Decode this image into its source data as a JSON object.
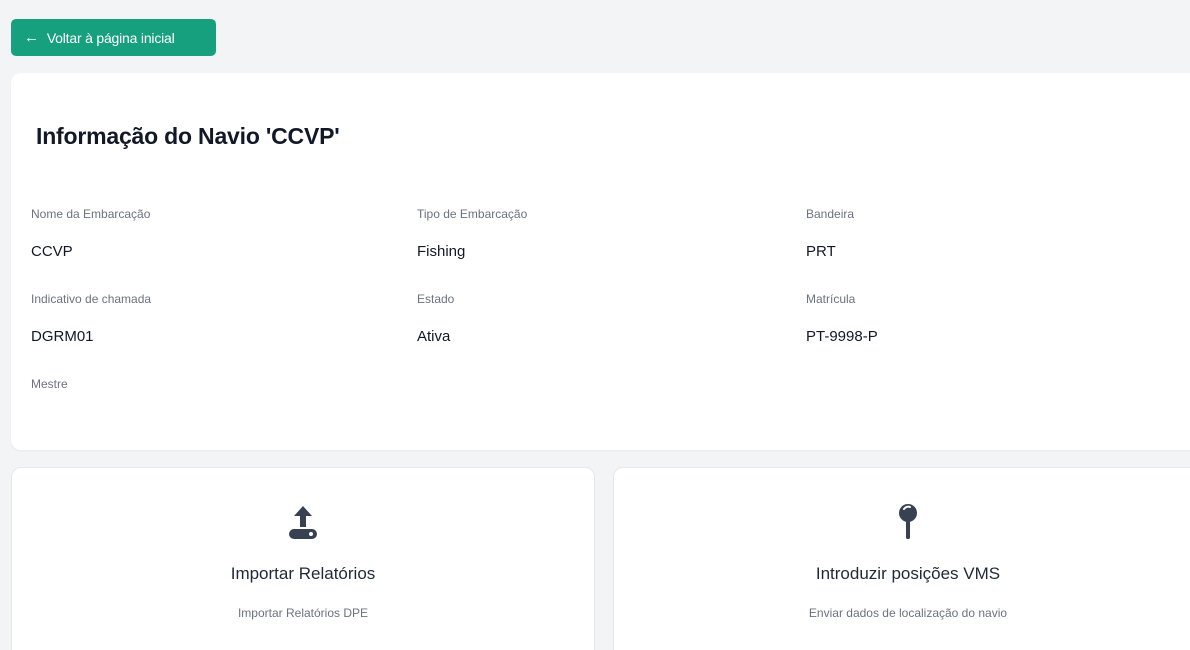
{
  "header": {
    "back_label": "Voltar à página inicial"
  },
  "vessel": {
    "title": "Informação do Navio 'CCVP'",
    "fields": [
      {
        "label": "Nome da Embarcação",
        "value": "CCVP"
      },
      {
        "label": "Tipo de Embarcação",
        "value": "Fishing"
      },
      {
        "label": "Bandeira",
        "value": "PRT"
      },
      {
        "label": "Indicativo de chamada",
        "value": "DGRM01"
      },
      {
        "label": "Estado",
        "value": "Ativa"
      },
      {
        "label": "Matrícula",
        "value": "PT-9998-P"
      },
      {
        "label": "Mestre",
        "value": ""
      }
    ]
  },
  "actions": [
    {
      "title": "Importar Relatórios",
      "description": "Importar Relatórios DPE",
      "icon": "upload-icon"
    },
    {
      "title": "Introduzir posições VMS",
      "description": "Enviar dados de localização do navio",
      "icon": "map-pin-icon"
    }
  ],
  "colors": {
    "accent": "#16a07e",
    "background": "#f3f4f6",
    "card": "#ffffff",
    "icon": "#374151"
  }
}
